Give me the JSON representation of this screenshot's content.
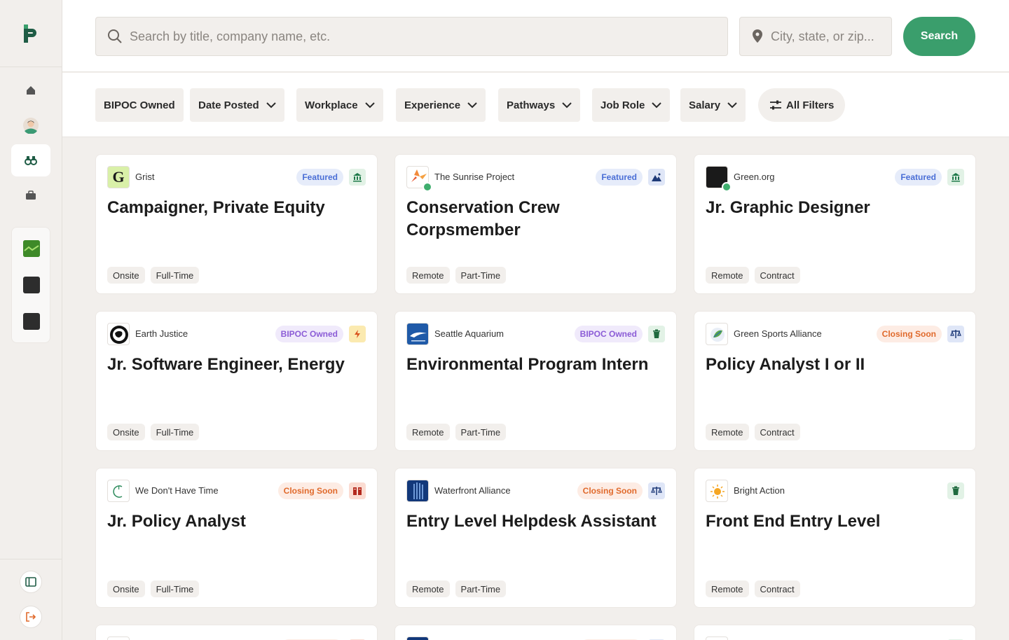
{
  "search": {
    "placeholder": "Search by title, company name, etc.",
    "location_placeholder": "City, state, or zip...",
    "button_label": "Search"
  },
  "filters": [
    "BIPOC Owned",
    "Date Posted",
    "Workplace",
    "Experience",
    "Pathways",
    "Job Role",
    "Salary",
    "All Filters"
  ],
  "colors": {
    "brand_green": "#1f5c45",
    "search_button": "#3a9e6c",
    "featured": "#4a6ed6",
    "bipoc": "#8b5cd6",
    "closing": "#e06a2c"
  },
  "jobs": [
    {
      "company": "Grist",
      "badge": "Featured",
      "title": "Campaigner, Private Equity",
      "workplace": "Onsite",
      "type": "Full-Time",
      "pathway_icon": "bank-icon"
    },
    {
      "company": "The Sunrise Project",
      "badge": "Featured",
      "title": "Conservation Crew Corpsmember",
      "workplace": "Remote",
      "type": "Part-Time",
      "pathway_icon": "mountain-icon"
    },
    {
      "company": "Green.org",
      "badge": "Featured",
      "title": "Jr. Graphic Designer",
      "workplace": "Remote",
      "type": "Contract",
      "pathway_icon": "bank-icon"
    },
    {
      "company": "Earth Justice",
      "badge": "BIPOC Owned",
      "title": "Jr. Software Engineer, Energy",
      "workplace": "Onsite",
      "type": "Full-Time",
      "pathway_icon": "lightning-icon"
    },
    {
      "company": "Seattle Aquarium",
      "badge": "BIPOC Owned",
      "title": "Environmental Program Intern",
      "workplace": "Remote",
      "type": "Part-Time",
      "pathway_icon": "trash-icon"
    },
    {
      "company": "Green Sports Alliance",
      "badge": "Closing Soon",
      "title": "Policy Analyst I or II",
      "workplace": "Remote",
      "type": "Contract",
      "pathway_icon": "scale-icon"
    },
    {
      "company": "We Don't Have Time",
      "badge": "Closing Soon",
      "title": "Jr. Policy Analyst",
      "workplace": "Onsite",
      "type": "Full-Time",
      "pathway_icon": "books-icon"
    },
    {
      "company": "Waterfront Alliance",
      "badge": "Closing Soon",
      "title": "Entry Level Helpdesk Assistant",
      "workplace": "Remote",
      "type": "Part-Time",
      "pathway_icon": "scale-icon"
    },
    {
      "company": "Bright Action",
      "badge": "",
      "title": "Front End Entry Level",
      "workplace": "Remote",
      "type": "Contract",
      "pathway_icon": "trash-icon"
    }
  ]
}
